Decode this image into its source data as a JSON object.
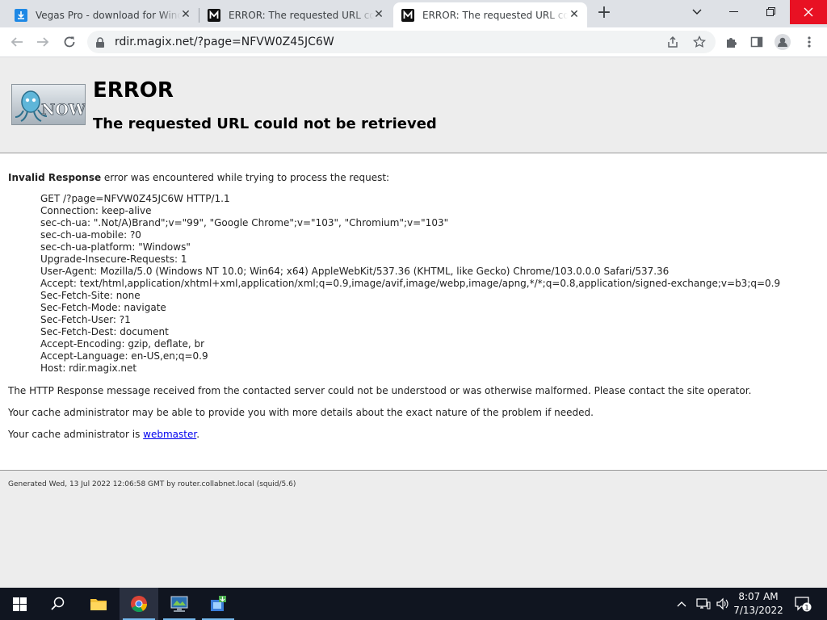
{
  "browser": {
    "tabs": [
      {
        "title": "Vegas Pro - download for Windows"
      },
      {
        "title": "ERROR: The requested URL could not be retrieved"
      },
      {
        "title": "ERROR: The requested URL could not be retrieved"
      }
    ],
    "url": "rdir.magix.net/?page=NFVW0Z45JC6W"
  },
  "page": {
    "logo_text": "NOW",
    "heading": "ERROR",
    "subheading": "The requested URL could not be retrieved",
    "intro_bold": "Invalid Response",
    "intro_rest": " error was encountered while trying to process the request:",
    "request_lines": [
      "GET /?page=NFVW0Z45JC6W HTTP/1.1",
      "Connection: keep-alive",
      "sec-ch-ua: \".Not/A)Brand\";v=\"99\", \"Google Chrome\";v=\"103\", \"Chromium\";v=\"103\"",
      "sec-ch-ua-mobile: ?0",
      "sec-ch-ua-platform: \"Windows\"",
      "Upgrade-Insecure-Requests: 1",
      "User-Agent: Mozilla/5.0 (Windows NT 10.0; Win64; x64) AppleWebKit/537.36 (KHTML, like Gecko) Chrome/103.0.0.0 Safari/537.36",
      "Accept: text/html,application/xhtml+xml,application/xml;q=0.9,image/avif,image/webp,image/apng,*/*;q=0.8,application/signed-exchange;v=b3;q=0.9",
      "Sec-Fetch-Site: none",
      "Sec-Fetch-Mode: navigate",
      "Sec-Fetch-User: ?1",
      "Sec-Fetch-Dest: document",
      "Accept-Encoding: gzip, deflate, br",
      "Accept-Language: en-US,en;q=0.9",
      "Host: rdir.magix.net"
    ],
    "para1": "The HTTP Response message received from the contacted server could not be understood or was otherwise malformed. Please contact the site operator.",
    "para2": "Your cache administrator may be able to provide you with more details about the exact nature of the problem if needed.",
    "para3_prefix": "Your cache administrator is ",
    "para3_link": "webmaster",
    "para3_suffix": ".",
    "footer": "Generated Wed, 13 Jul 2022 12:06:58 GMT by router.collabnet.local (squid/5.6)"
  },
  "taskbar": {
    "time": "8:07 AM",
    "date": "7/13/2022",
    "notification_count": "1"
  },
  "colors": {
    "accent": "#1a73e8",
    "link": "#0000ee"
  }
}
